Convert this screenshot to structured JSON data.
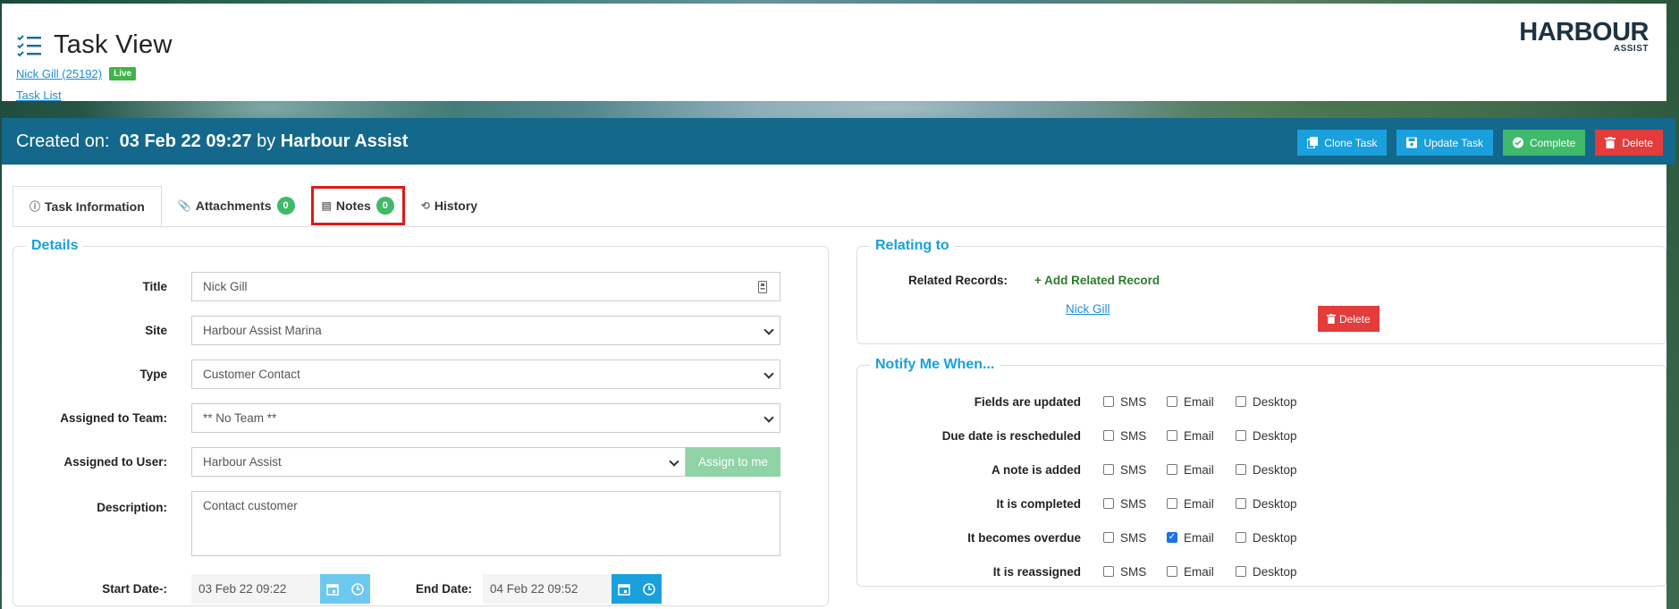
{
  "header": {
    "title": "Task View",
    "user_link": "Nick Gill (25192)",
    "status_badge": "Live",
    "task_list_link": "Task List",
    "logo_text": "HARBOUR",
    "logo_sub": "ASSIST"
  },
  "created_bar": {
    "prefix": "Created on:",
    "date": "03 Feb 22 09:27",
    "by": "by",
    "author": "Harbour Assist",
    "buttons": {
      "clone": "Clone Task",
      "update": "Update Task",
      "complete": "Complete",
      "delete": "Delete"
    }
  },
  "tabs": [
    {
      "label": "Task Information"
    },
    {
      "label": "Attachments",
      "count": "0"
    },
    {
      "label": "Notes",
      "count": "0"
    },
    {
      "label": "History"
    }
  ],
  "details": {
    "legend": "Details",
    "title_label": "Title",
    "title_value": "Nick Gill",
    "site_label": "Site",
    "site_value": "Harbour Assist Marina",
    "type_label": "Type",
    "type_value": "Customer Contact",
    "team_label": "Assigned to Team:",
    "team_value": "** No Team **",
    "user_label": "Assigned to User:",
    "user_value": "Harbour Assist",
    "assign_btn": "Assign to me",
    "desc_label": "Description:",
    "desc_value": "Contact customer",
    "start_label": "Start Date-:",
    "start_value": "03 Feb 22 09:22",
    "end_label": "End Date:",
    "end_value": "04 Feb 22 09:52"
  },
  "relating": {
    "legend": "Relating to",
    "records_label": "Related Records:",
    "add_link": "+ Add Related Record",
    "record_link": "Nick Gill",
    "delete_btn": "Delete"
  },
  "notify": {
    "legend": "Notify Me When...",
    "options": [
      "SMS",
      "Email",
      "Desktop"
    ],
    "rows": [
      {
        "label": "Fields are updated",
        "sms": false,
        "email": false,
        "desktop": false
      },
      {
        "label": "Due date is rescheduled",
        "sms": false,
        "email": false,
        "desktop": false
      },
      {
        "label": "A note is added",
        "sms": false,
        "email": false,
        "desktop": false
      },
      {
        "label": "It is completed",
        "sms": false,
        "email": false,
        "desktop": false
      },
      {
        "label": "It becomes overdue",
        "sms": false,
        "email": true,
        "desktop": false
      },
      {
        "label": "It is reassigned",
        "sms": false,
        "email": false,
        "desktop": false
      }
    ]
  },
  "colors": {
    "accent": "#1aa0dc",
    "bar": "#13688c",
    "success": "#3fba6a",
    "danger": "#e43b3b",
    "highlight": "#e01818"
  }
}
